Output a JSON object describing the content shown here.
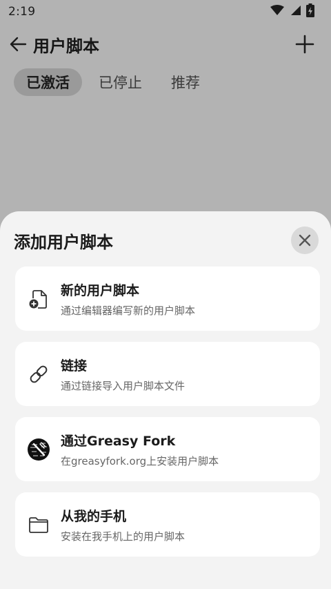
{
  "status_bar": {
    "time": "2:19",
    "icons": [
      "wifi-icon",
      "signal-icon",
      "battery-icon"
    ]
  },
  "app_bar": {
    "title": "用户脚本",
    "back_icon": "arrow-left-icon",
    "add_icon": "plus-icon"
  },
  "tabs": [
    {
      "label": "已激活",
      "active": true
    },
    {
      "label": "已停止",
      "active": false
    },
    {
      "label": "推荐",
      "active": false
    }
  ],
  "sheet": {
    "title": "添加用户脚本",
    "close_icon": "close-icon",
    "options": [
      {
        "icon": "new-file-icon",
        "title": "新的用户脚本",
        "desc": "通过编辑器编写新的用户脚本"
      },
      {
        "icon": "link-icon",
        "title": "链接",
        "desc": "通过链接导入用户脚本文件"
      },
      {
        "icon": "greasyfork-logo-icon",
        "title": "通过Greasy Fork",
        "desc": "在greasyfork.org上安装用户脚本"
      },
      {
        "icon": "folder-icon",
        "title": "从我的手机",
        "desc": "安装在我手机上的用户脚本"
      }
    ]
  },
  "colors": {
    "scrim_background": "#b3b3b3",
    "sheet_background": "#f3f3f3",
    "card_background": "#ffffff",
    "active_tab": "#9a9a9a",
    "close_button": "#d9d9d9"
  }
}
